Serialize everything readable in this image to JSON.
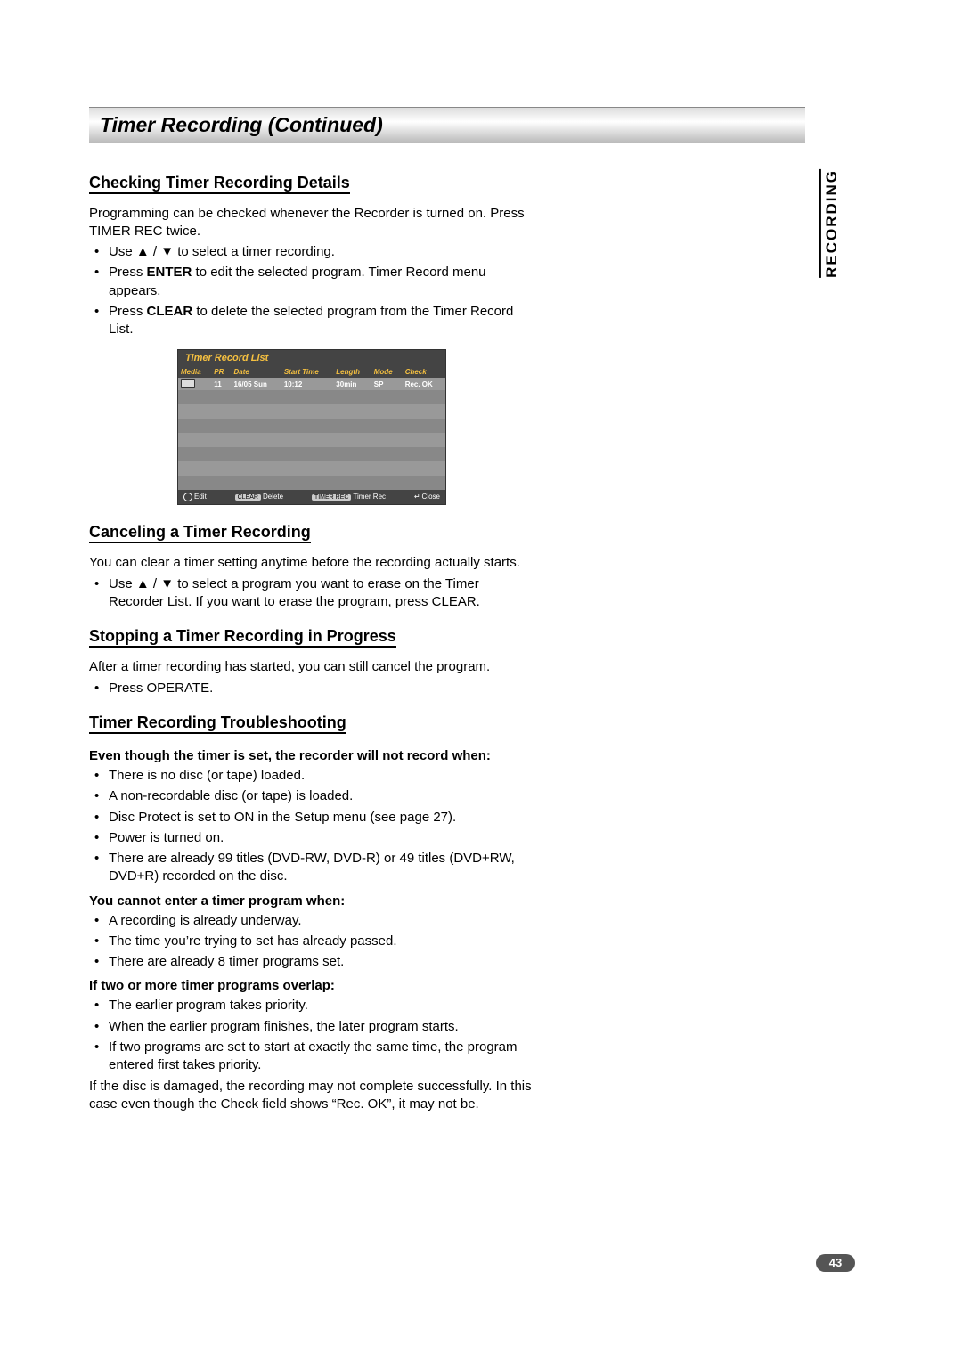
{
  "banner_title": "Timer Recording  (Continued)",
  "side_tab": "RECORDING",
  "page_number": "43",
  "sec1": {
    "heading": "Checking Timer Recording Details",
    "intro": "Programming can be checked whenever the Recorder is turned on. Press TIMER REC twice.",
    "b1": "Use ▲ / ▼ to select a timer recording.",
    "b2a": "Press ",
    "b2b": "ENTER",
    "b2c": " to edit the selected program. Timer Record menu appears.",
    "b3a": "Press ",
    "b3b": "CLEAR",
    "b3c": " to delete the selected program from the Timer Record List."
  },
  "osd": {
    "title": "Timer Record List",
    "headers": {
      "media": "Media",
      "pr": "PR",
      "date": "Date",
      "start": "Start Time",
      "length": "Length",
      "mode": "Mode",
      "check": "Check"
    },
    "row1": {
      "pr": "11",
      "date": "16/05 Sun",
      "start": "10:12",
      "length": "30min",
      "mode": "SP",
      "check": "Rec. OK"
    },
    "footer": {
      "edit": "Edit",
      "clear_label": "CLEAR",
      "delete": "Delete",
      "timer_rec_label": "TIMER REC",
      "timer_rec": "Timer Rec",
      "close": "Close"
    }
  },
  "sec2": {
    "heading": "Canceling a Timer Recording",
    "intro": "You can clear a timer setting anytime before the recording actually starts.",
    "b1": "Use ▲ / ▼ to select a program you want to erase on the Timer Recorder List. If you want to erase the program, press CLEAR."
  },
  "sec3": {
    "heading": "Stopping a Timer Recording in Progress",
    "intro": "After a timer recording has started, you can still cancel the program.",
    "b1": "Press OPERATE."
  },
  "sec4": {
    "heading": "Timer Recording Troubleshooting",
    "h1": "Even though the timer is set, the recorder will not record when:",
    "h1_items": [
      "There is no disc (or tape) loaded.",
      "A non-recordable disc (or tape) is loaded.",
      "Disc Protect is set to ON in the Setup menu (see page 27).",
      "Power is turned on.",
      "There are already 99 titles (DVD-RW, DVD-R) or 49 titles (DVD+RW, DVD+R) recorded on the disc."
    ],
    "h2": "You cannot enter a timer program when:",
    "h2_items": [
      "A recording is already underway.",
      "The time you’re trying to set has already passed.",
      "There are already 8 timer programs set."
    ],
    "h3": "If two or more timer programs overlap:",
    "h3_items": [
      "The earlier program takes priority.",
      "When the earlier program finishes, the later program starts.",
      "If two programs are set to start at exactly the same time, the program entered first takes priority."
    ],
    "outro": "If the disc is damaged, the recording may not complete successfully. In this case even though the Check field shows “Rec. OK”, it may not be."
  }
}
